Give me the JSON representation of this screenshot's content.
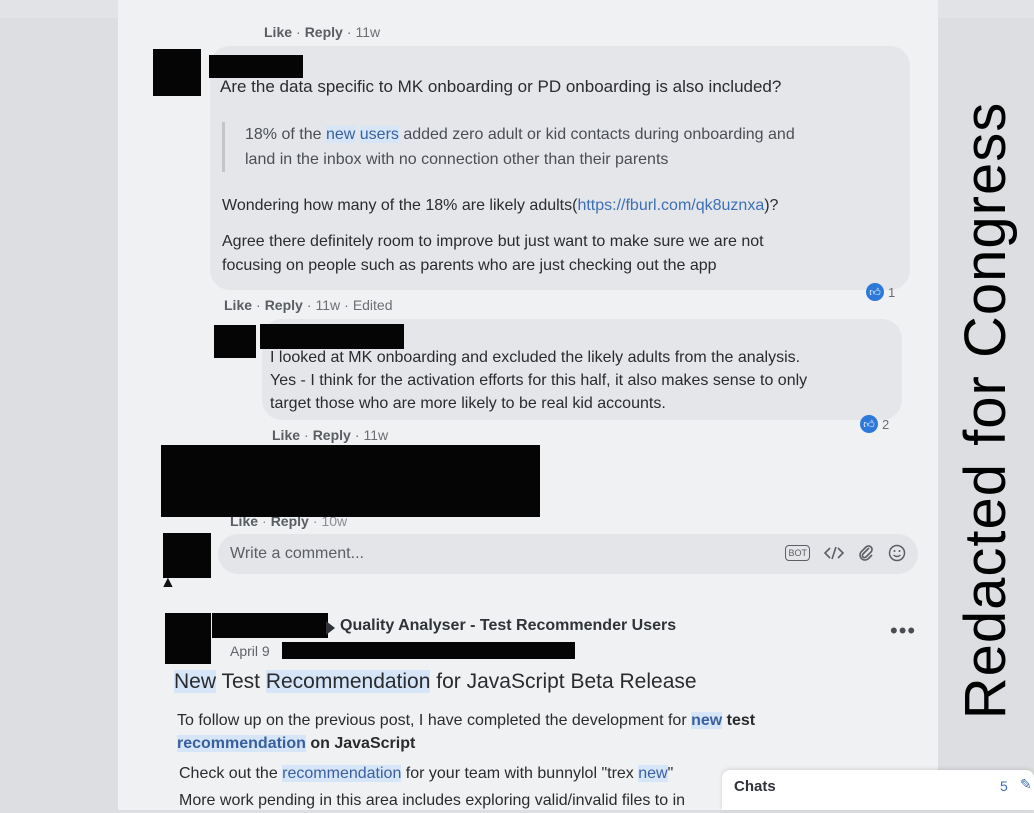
{
  "top_comment_meta": {
    "like": "Like",
    "reply": "Reply",
    "age": "11w"
  },
  "comment1": {
    "question": "Are the data specific to MK onboarding or PD onboarding is also included?",
    "quote_part1": "18% of the ",
    "quote_hl1": "new",
    "quote_hl2": "users",
    "quote_part2": " added zero adult or kid contacts during onboarding and",
    "quote_line2": "land in the inbox with no connection other than their parents",
    "wonder_prefix": "Wondering how many of the 18% are likely adults(",
    "wonder_link": "https://fburl.com/qk8uznxa",
    "wonder_suffix": ")?",
    "agree_line1": "Agree there definitely room to improve but just want to make sure we are not",
    "agree_line2": "focusing on people such as parents who are just checking out the app",
    "like": "Like",
    "reply": "Reply",
    "age": "11w",
    "edited": "Edited",
    "reactions": "1"
  },
  "reply1": {
    "line1": "I looked at MK onboarding and excluded the likely adults from the analysis.",
    "line2": "Yes - I think for the activation efforts for this half, it also makes sense to only",
    "line3": "target those who are more likely to be real kid accounts.",
    "like": "Like",
    "reply": "Reply",
    "age": "11w",
    "reactions": "2"
  },
  "reply2_meta": {
    "like": "Like",
    "reply": "Reply",
    "age": "10w"
  },
  "comment_box": {
    "placeholder": "Write a comment...",
    "bot_label": "BOT"
  },
  "post": {
    "group": "Quality Analyser - Test Recommender Users",
    "date": "April 9",
    "title_hl1": "New",
    "title_mid": " Test ",
    "title_hl2": "Recommendation",
    "title_rest": " for JavaScript Beta Release",
    "body1_prefix": "To follow up on the previous post, I have completed the development for ",
    "body1_hl1": "new",
    "body1_hl2": "test",
    "body1_hl3": "recommendation",
    "body1_suffix": " on JavaScript",
    "body2_prefix": "Check out the ",
    "body2_hl1": "recommendation",
    "body2_mid": " for your team with bunnylol \"trex ",
    "body2_hl2": "new",
    "body2_suffix": "\"",
    "body3": "More work pending in this area includes exploring valid/invalid files to in"
  },
  "chats": {
    "label": "Chats",
    "count": "5"
  },
  "watermark": "Redacted for Congress"
}
